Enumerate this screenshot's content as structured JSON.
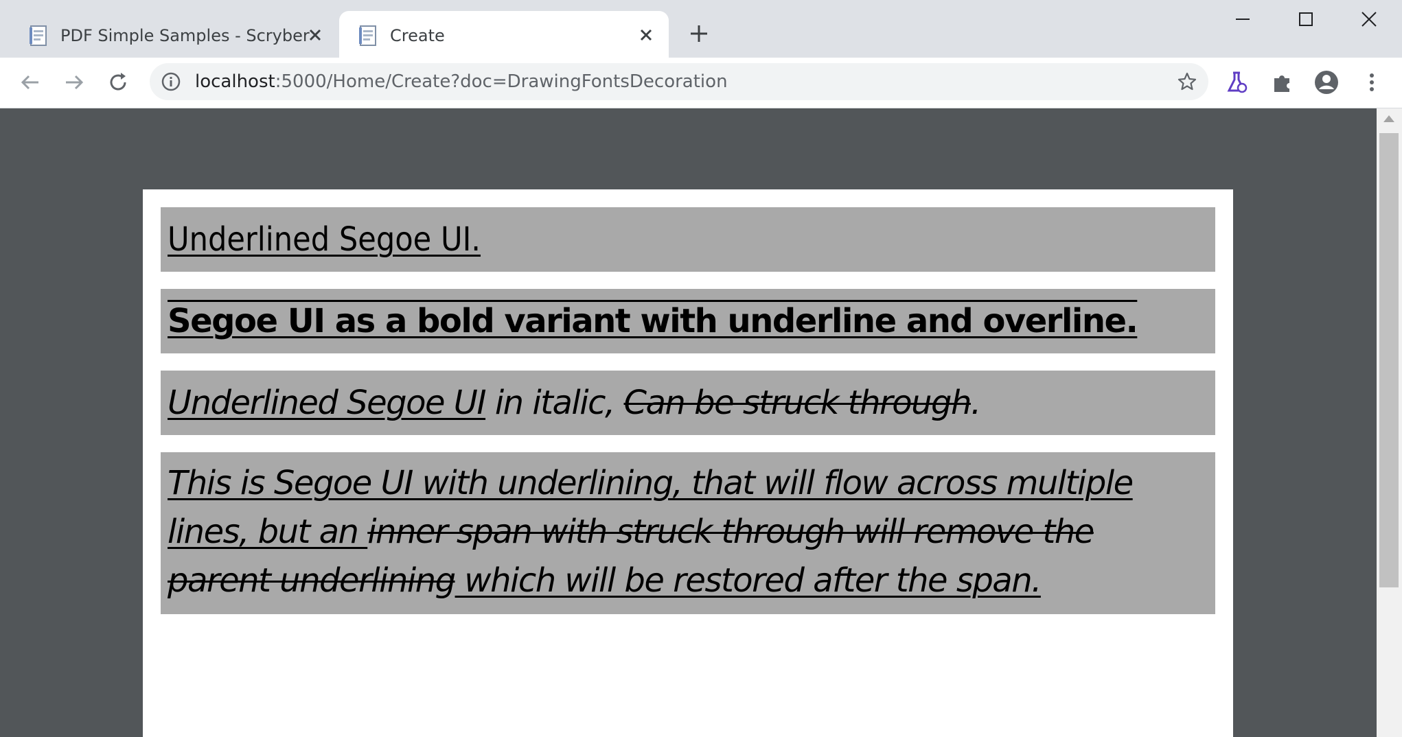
{
  "browser": {
    "tabs": [
      {
        "title": "PDF Simple Samples - Scryber",
        "active": false,
        "favicon": "document-icon"
      },
      {
        "title": "Create",
        "active": true,
        "favicon": "document-icon"
      }
    ],
    "address": {
      "host": "localhost",
      "rest": ":5000/Home/Create?doc=DrawingFontsDecoration"
    },
    "icons": {
      "back": "arrow-left-icon",
      "forward": "arrow-right-icon",
      "reload": "reload-icon",
      "info": "info-icon",
      "bookmark": "star-icon",
      "labs": "flask-icon",
      "extensions": "puzzle-icon",
      "profile": "account-icon",
      "menu": "more-vert-icon"
    }
  },
  "document": {
    "block1": {
      "text": "Underlined Segoe UI."
    },
    "block2": {
      "text": "Segoe UI as a bold variant with underline and overline."
    },
    "block3": {
      "underlined": "Underlined Segoe UI",
      "plain": " in italic, ",
      "struck": "Can be struck through",
      "end": "."
    },
    "block4": {
      "line1": "This is Segoe UI with underlining, that will flow across multiple",
      "line2_ul": "lines, but an ",
      "line2_st": "inner span with struck through will remove the",
      "line3_st": "parent underlining",
      "line3_ul": " which will be restored after the span. "
    }
  }
}
